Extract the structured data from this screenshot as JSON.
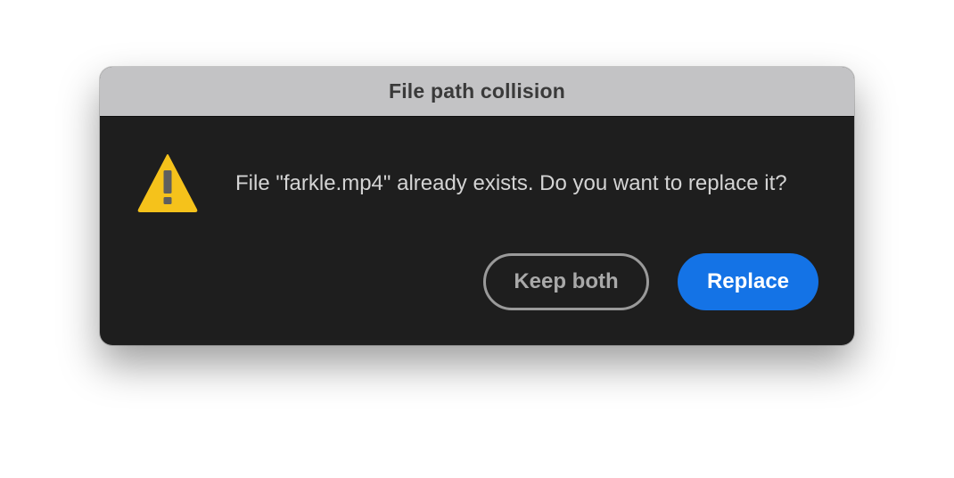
{
  "dialog": {
    "title": "File path collision",
    "icon": "warning-icon",
    "message": "File \"farkle.mp4\" already exists. Do you want to replace it?",
    "buttons": {
      "keep_both": "Keep both",
      "replace": "Replace"
    },
    "colors": {
      "titlebar": "#c3c3c5",
      "background": "#1e1e1e",
      "warning": "#f5c21b",
      "primary": "#1473e6"
    }
  }
}
